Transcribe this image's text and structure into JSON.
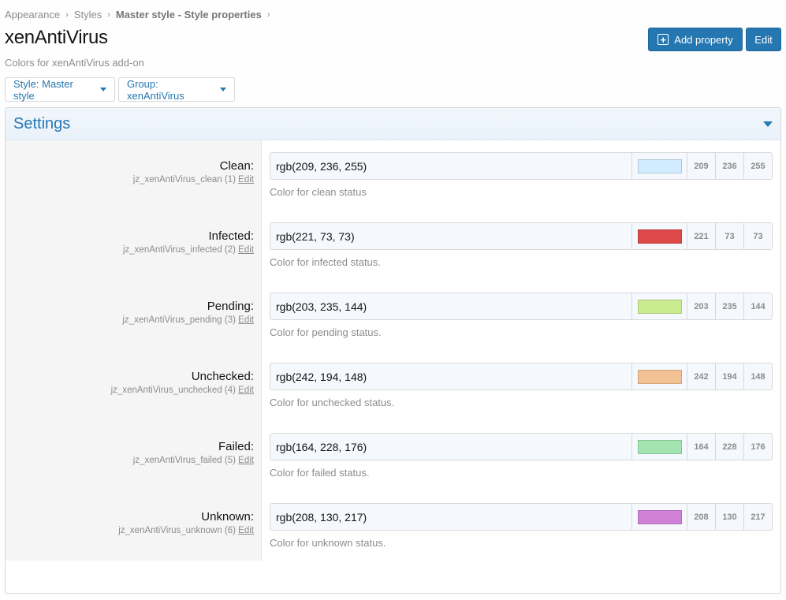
{
  "breadcrumb": [
    {
      "label": "Appearance"
    },
    {
      "label": "Styles"
    },
    {
      "label": "Master style - Style properties"
    }
  ],
  "page": {
    "title": "xenAntiVirus",
    "description": "Colors for xenAntiVirus add-on"
  },
  "actions": {
    "add_property": "Add property",
    "edit": "Edit"
  },
  "filters": {
    "style": "Style: Master style",
    "group": "Group: xenAntiVirus"
  },
  "panel": {
    "title": "Settings"
  },
  "properties": [
    {
      "label": "Clean:",
      "meta": "jz_xenAntiVirus_clean (1)",
      "edit": "Edit",
      "value": "rgb(209, 236, 255)",
      "color": "#d1ecff",
      "r": "209",
      "g": "236",
      "b": "255",
      "desc": "Color for clean status"
    },
    {
      "label": "Infected:",
      "meta": "jz_xenAntiVirus_infected (2)",
      "edit": "Edit",
      "value": "rgb(221, 73, 73)",
      "color": "#dd4949",
      "r": "221",
      "g": "73",
      "b": "73",
      "desc": "Color for infected status."
    },
    {
      "label": "Pending:",
      "meta": "jz_xenAntiVirus_pending (3)",
      "edit": "Edit",
      "value": "rgb(203, 235, 144)",
      "color": "#cbeb90",
      "r": "203",
      "g": "235",
      "b": "144",
      "desc": "Color for pending status."
    },
    {
      "label": "Unchecked:",
      "meta": "jz_xenAntiVirus_unchecked (4)",
      "edit": "Edit",
      "value": "rgb(242, 194, 148)",
      "color": "#f2c294",
      "r": "242",
      "g": "194",
      "b": "148",
      "desc": "Color for unchecked status."
    },
    {
      "label": "Failed:",
      "meta": "jz_xenAntiVirus_failed (5)",
      "edit": "Edit",
      "value": "rgb(164, 228, 176)",
      "color": "#a4e4b0",
      "r": "164",
      "g": "228",
      "b": "176",
      "desc": "Color for failed status."
    },
    {
      "label": "Unknown:",
      "meta": "jz_xenAntiVirus_unknown (6)",
      "edit": "Edit",
      "value": "rgb(208, 130, 217)",
      "color": "#d082d9",
      "r": "208",
      "g": "130",
      "b": "217",
      "desc": "Color for unknown status."
    }
  ]
}
